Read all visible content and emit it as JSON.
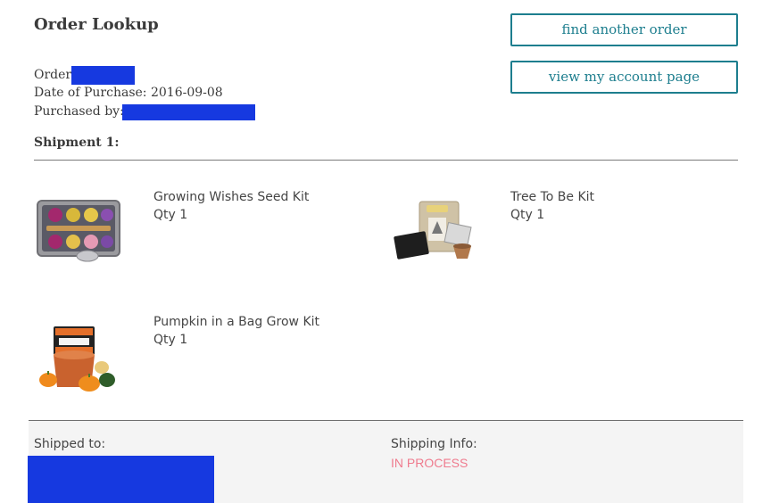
{
  "page": {
    "title": "Order Lookup",
    "order_label": "Order",
    "date_label": "Date of Purchase:",
    "date_value": "2016-09-08",
    "purchased_by_label": "Purchased by:"
  },
  "buttons": {
    "find_another": "find another order",
    "view_account": "view my account page"
  },
  "shipment": {
    "heading": "Shipment 1:",
    "items": [
      {
        "name": "Growing Wishes Seed Kit",
        "qty": "Qty 1",
        "icon": "seed-kit-tin-image"
      },
      {
        "name": "Tree To Be Kit",
        "qty": "Qty 1",
        "icon": "tree-kit-bag-image"
      },
      {
        "name": "Pumpkin in a Bag Grow Kit",
        "qty": "Qty 1",
        "icon": "pumpkin-kit-image"
      }
    ]
  },
  "footer": {
    "shipped_to_label": "Shipped to:",
    "shipping_info_label": "Shipping Info:",
    "status": "IN PROCESS"
  },
  "colors": {
    "accent": "#1d7e8e",
    "redaction": "#1639e0",
    "status": "#ef7b8e",
    "footer_bg": "#f4f4f4"
  }
}
